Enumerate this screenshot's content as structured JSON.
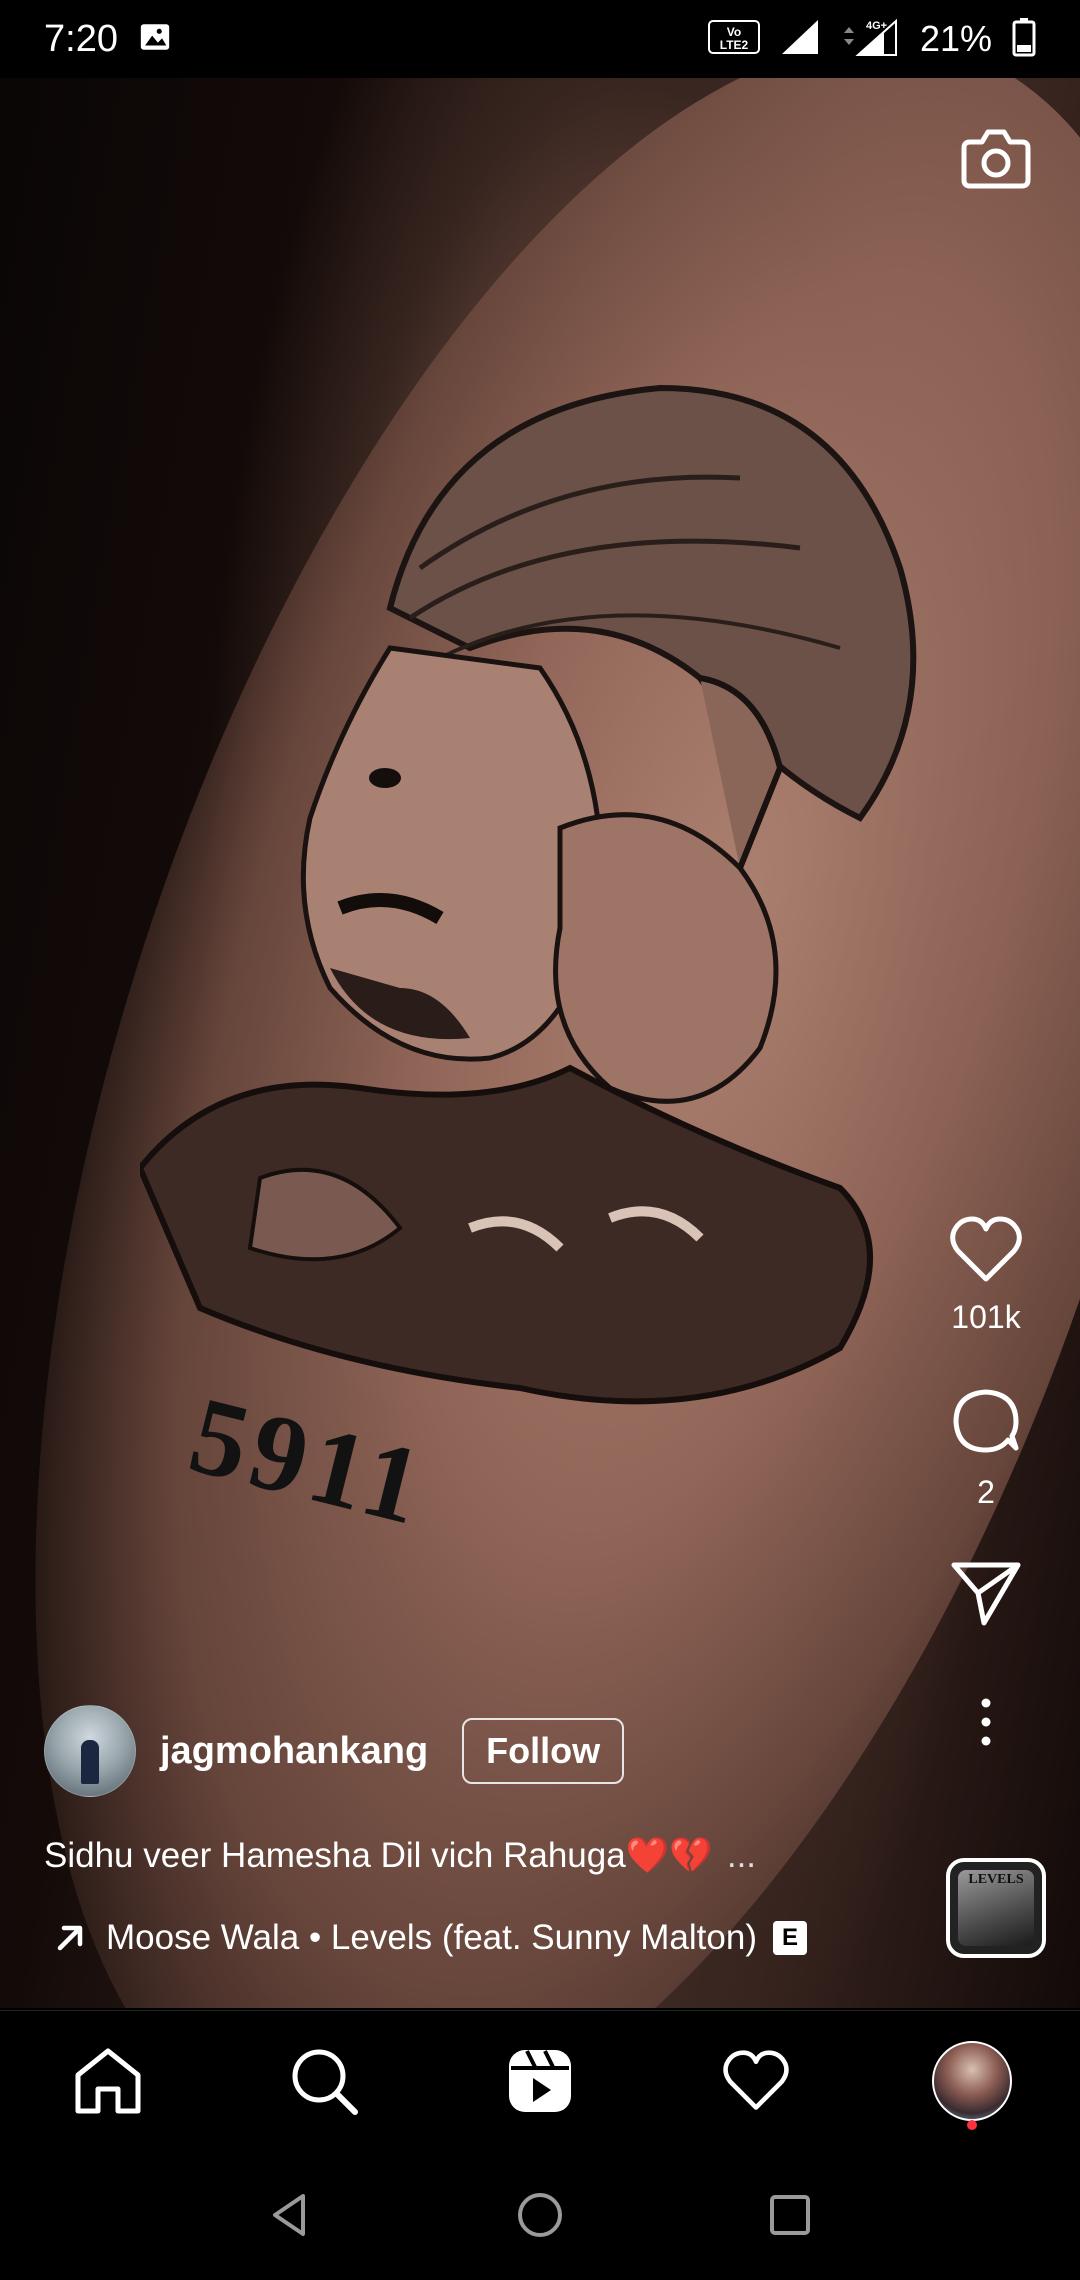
{
  "status_bar": {
    "time": "7:20",
    "battery_percent": "21%",
    "network_label_1": "VoLTE2",
    "network_label_2": "4G+"
  },
  "post": {
    "author": {
      "username": "jagmohankang",
      "follow_label": "Follow"
    },
    "caption": "Sidhu veer Hamesha Dil vich Rahuga❤️💔",
    "caption_more": "...",
    "audio": {
      "label": "Moose Wala • Levels (feat. Sunny Malton)",
      "explicit_badge": "E",
      "thumb_text": "LEVELS"
    },
    "tattoo_text": "5911",
    "actions": {
      "likes": "101k",
      "comments": "2"
    }
  },
  "icons": {
    "camera": "camera-icon",
    "like": "heart-icon",
    "comment": "comment-icon",
    "share": "paper-plane-icon",
    "more": "more-vertical-icon",
    "home": "home-icon",
    "search": "search-icon",
    "reels": "reels-icon",
    "activity": "heart-icon",
    "profile": "avatar"
  },
  "colors": {
    "background": "#000000",
    "text": "#ffffff",
    "notification_dot": "#ff3040"
  }
}
